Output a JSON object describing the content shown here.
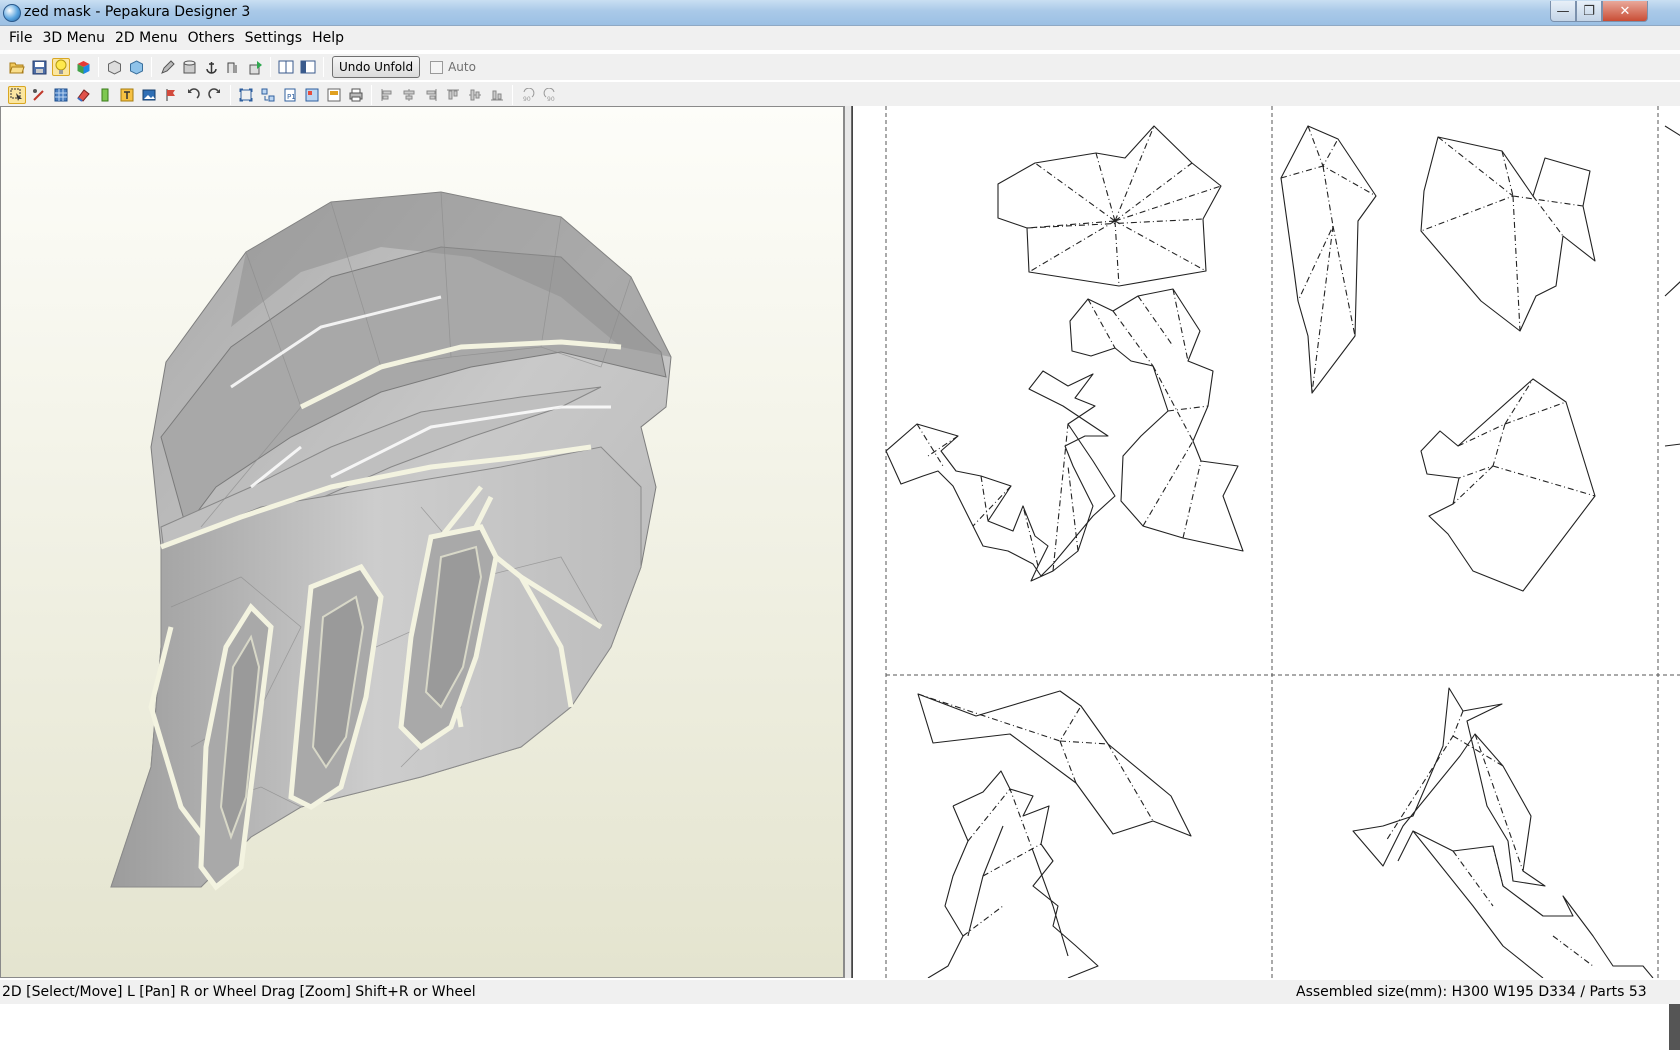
{
  "window": {
    "title": "zed mask - Pepakura Designer 3",
    "minimize_glyph": "—",
    "maximize_glyph": "❐",
    "close_glyph": "✕"
  },
  "menu": [
    "File",
    "3D Menu",
    "2D Menu",
    "Others",
    "Settings",
    "Help"
  ],
  "toolbar1": {
    "icons": [
      "open-icon",
      "save-icon",
      "lightbulb-icon",
      "color-cube-icon",
      "box-icon",
      "texture-box-icon",
      "pencil-icon",
      "cylinder-icon",
      "anchor-icon",
      "edge-icon",
      "green-arrow-icon",
      "single-pane-icon",
      "split-pane-icon"
    ],
    "undo_unfold_label": "Undo Unfold",
    "auto_label": "Auto"
  },
  "toolbar2": {
    "icons": [
      "select-tool-icon",
      "pen-tool-icon",
      "grid-icon",
      "eraser-icon",
      "glue-tab-icon",
      "text-icon",
      "image-icon",
      "flag-icon",
      "rotate-left-icon",
      "rotate-right-icon",
      "fit-icon",
      "arrange-icon",
      "page-icon",
      "layout-icon",
      "paper-icon",
      "print-icon",
      "align-left-icon",
      "align-center-icon",
      "align-right-icon",
      "align-top-icon",
      "align-middle-icon",
      "align-bottom-icon",
      "rotate-90-icon",
      "rotate-90ccw-icon"
    ]
  },
  "status": {
    "left": "2D [Select/Move] L [Pan] R or Wheel Drag [Zoom] Shift+R or Wheel",
    "right": "Assembled size(mm): H300 W195 D334 / Parts 53"
  },
  "colors": {
    "mesh_light": "#cfcfcf",
    "mesh_dark": "#8e8e8e",
    "seam": "#f4f4e4",
    "pattern_line": "#222222"
  }
}
